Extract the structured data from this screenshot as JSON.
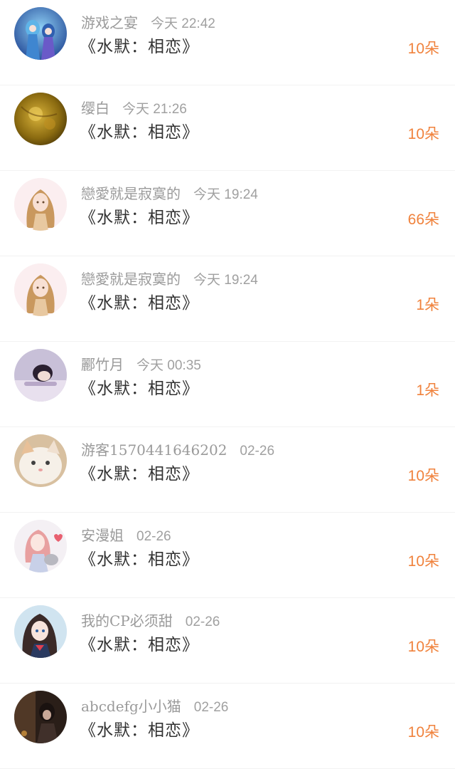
{
  "colors": {
    "accent": "#f0823c",
    "meta_text": "#9a9a9a",
    "title_text": "#333333",
    "divider": "#f2f2f2"
  },
  "items": [
    {
      "name": "游戏之宴",
      "time": "今天 22:42",
      "title": "《水默：相恋》",
      "count": "10朵",
      "avatar": "blue-anime-couple"
    },
    {
      "name": "缨白",
      "time": "今天 21:26",
      "title": "《水默：相恋》",
      "count": "10朵",
      "avatar": "golden-blur"
    },
    {
      "name": "戀愛就是寂寞的",
      "time": "今天 19:24",
      "title": "《水默：相恋》",
      "count": "66朵",
      "avatar": "anime-girl-curly"
    },
    {
      "name": "戀愛就是寂寞的",
      "time": "今天 19:24",
      "title": "《水默：相恋》",
      "count": "1朵",
      "avatar": "anime-girl-curly"
    },
    {
      "name": "酈竹月",
      "time": "今天 00:35",
      "title": "《水默：相恋》",
      "count": "1朵",
      "avatar": "sleeping-girl"
    },
    {
      "name": "游客1570441646202",
      "time": "02-26",
      "title": "《水默：相恋》",
      "count": "10朵",
      "avatar": "white-cat"
    },
    {
      "name": "安漫姐",
      "time": "02-26",
      "title": "《水默：相恋》",
      "count": "10朵",
      "avatar": "anime-girl-cat"
    },
    {
      "name": "我的CP必须甜",
      "time": "02-26",
      "title": "《水默：相恋》",
      "count": "10朵",
      "avatar": "anime-girl-dark-hair"
    },
    {
      "name": "abcdefg小小猫",
      "time": "02-26",
      "title": "《水默：相恋》",
      "count": "10朵",
      "avatar": "dark-scene"
    }
  ]
}
